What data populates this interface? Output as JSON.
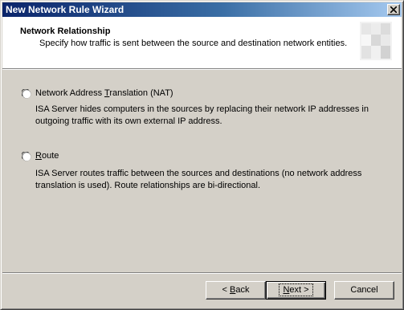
{
  "window": {
    "title": "New Network Rule Wizard"
  },
  "header": {
    "title": "Network Relationship",
    "subtitle": "Specify how traffic is sent between the source and destination network entities."
  },
  "options": [
    {
      "label_pre": "Network Address ",
      "label_accel": "T",
      "label_post": "ranslation (NAT)",
      "selected": false,
      "description_line1": "ISA Server hides computers in the sources by replacing their network IP addresses in",
      "description_line2": "outgoing traffic with its own external IP address."
    },
    {
      "label_pre": "",
      "label_accel": "R",
      "label_post": "oute",
      "selected": false,
      "description_line1": "ISA Server routes traffic between the sources and destinations (no network address",
      "description_line2": "translation is used). Route relationships are bi-directional."
    }
  ],
  "buttons": {
    "back_pre": "< ",
    "back_accel": "B",
    "back_post": "ack",
    "next_accel": "N",
    "next_post": "ext >",
    "cancel": "Cancel"
  },
  "icons": {
    "close": "close-icon",
    "header_graphic": "wizard-header-graphic"
  }
}
